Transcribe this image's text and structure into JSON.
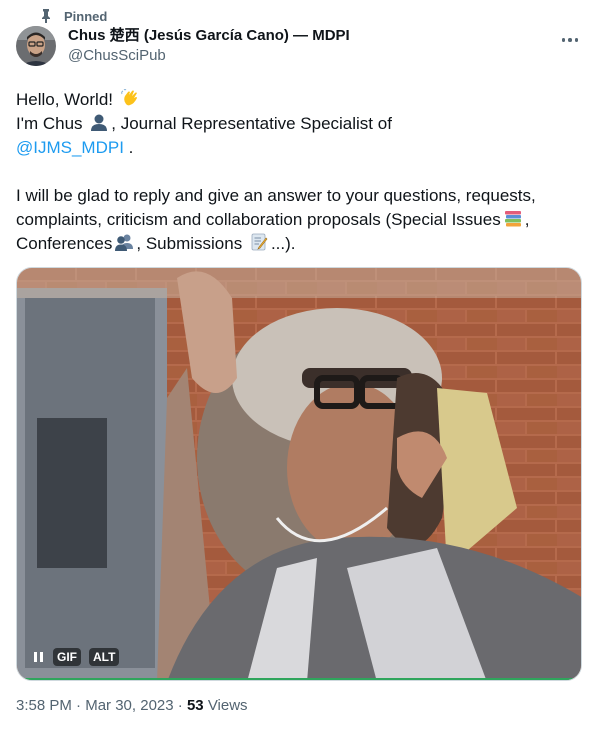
{
  "pinned_label": "Pinned",
  "author": {
    "display_name": "Chus 楚西 (Jesús García Cano) — MDPI",
    "handle": "@ChusSciPub"
  },
  "body": {
    "line1": "Hello, World!",
    "line2_a": "I'm Chus",
    "line2_b": ", Journal Representative Specialist of",
    "mention": "@IJMS_MDPI",
    "line3_tail": " .",
    "para2_line1": "I will be glad to reply and give an answer to your questions, requests,",
    "para2_line2": "complaints, criticism and collaboration proposals (Special Issues",
    "para2_line2_tail": ",",
    "para2_line3_a": "Conferences",
    "para2_line3_b": ", Submissions",
    "para2_line3_c": "...)."
  },
  "media": {
    "gif_label": "GIF",
    "alt_label": "ALT"
  },
  "meta": {
    "time": "3:58 PM",
    "separator": "·",
    "date": "Mar 30, 2023",
    "views_count": "53",
    "views_label": "Views"
  },
  "icons": {
    "pin": "pin-icon",
    "more": "more-icon",
    "wave": "waving-hand-icon",
    "user": "bust-icon",
    "books": "books-icon",
    "users": "busts-icon",
    "memo": "memo-icon",
    "pause": "pause-icon"
  },
  "colors": {
    "link": "#1d9bf0",
    "secondary_text": "#536471",
    "primary_text": "#0f1419"
  }
}
